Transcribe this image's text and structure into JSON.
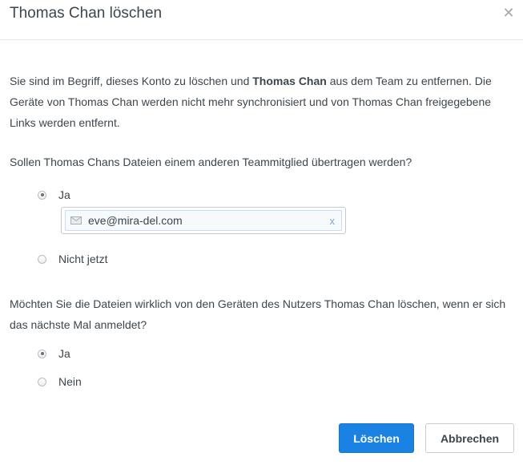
{
  "dialog": {
    "title": "Thomas Chan löschen",
    "close_icon": "close-icon"
  },
  "intro": {
    "part1": "Sie sind im Begriff, dieses Konto zu löschen und ",
    "name_bold": "Thomas Chan",
    "part2": " aus dem Team zu entfernen. Die Geräte von Thomas Chan werden nicht mehr synchronisiert und von Thomas Chan freigegebene Links werden entfernt."
  },
  "transfer": {
    "question": "Sollen Thomas Chans Dateien einem anderen Teammitglied übertragen werden?",
    "option_yes": "Ja",
    "option_no": "Nicht jetzt",
    "selected": "yes",
    "recipient_token": "eve@mira-del.com",
    "token_icon": "envelope-icon",
    "token_remove": "x"
  },
  "wipe": {
    "question": "Möchten Sie die Dateien wirklich von den Geräten des Nutzers Thomas Chan löschen, wenn er sich das nächste Mal anmeldet?",
    "option_yes": "Ja",
    "option_no": "Nein",
    "selected": "yes"
  },
  "buttons": {
    "delete": "Löschen",
    "cancel": "Abbrechen"
  },
  "colors": {
    "primary": "#1a82e2",
    "text": "#3d464d"
  }
}
